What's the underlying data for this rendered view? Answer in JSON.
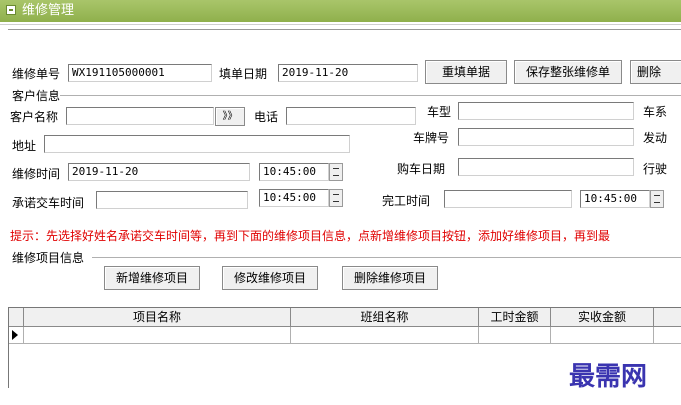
{
  "window": {
    "title": "维修管理"
  },
  "header": {
    "order_no_label": "维修单号",
    "order_no_value": "WX191105000001",
    "fill_date_label": "填单日期",
    "fill_date_value": "2019-11-20",
    "reset_button": "重填单据",
    "save_button": "保存整张维修单",
    "delete_button": "删除"
  },
  "customer": {
    "group_label": "客户信息",
    "name_label": "客户名称",
    "browse_button": "》》",
    "phone_label": "电话",
    "car_model_label": "车型",
    "car_series_label": "车系",
    "address_label": "地址",
    "plate_label": "车牌号",
    "engine_label": "发动",
    "repair_time_label": "维修时间",
    "repair_date_value": "2019-11-20",
    "repair_clock_value": "10:45:00",
    "purchase_date_label": "购车日期",
    "mileage_label": "行驶",
    "promise_time_label": "承诺交车时间",
    "promise_clock_value": "10:45:00",
    "finish_time_label": "完工时间",
    "finish_clock_value": "10:45:00"
  },
  "hint": "提示：先选择好姓名承诺交车时间等，再到下面的维修项目信息，点新增维修项目按钮，添加好维修项目，再到最",
  "items": {
    "group_label": "维修项目信息",
    "add_button": "新增维修项目",
    "edit_button": "修改维修项目",
    "remove_button": "删除维修项目",
    "columns": [
      "项目名称",
      "班组名称",
      "工时金额",
      "实收金额"
    ]
  },
  "watermark": "最需网"
}
